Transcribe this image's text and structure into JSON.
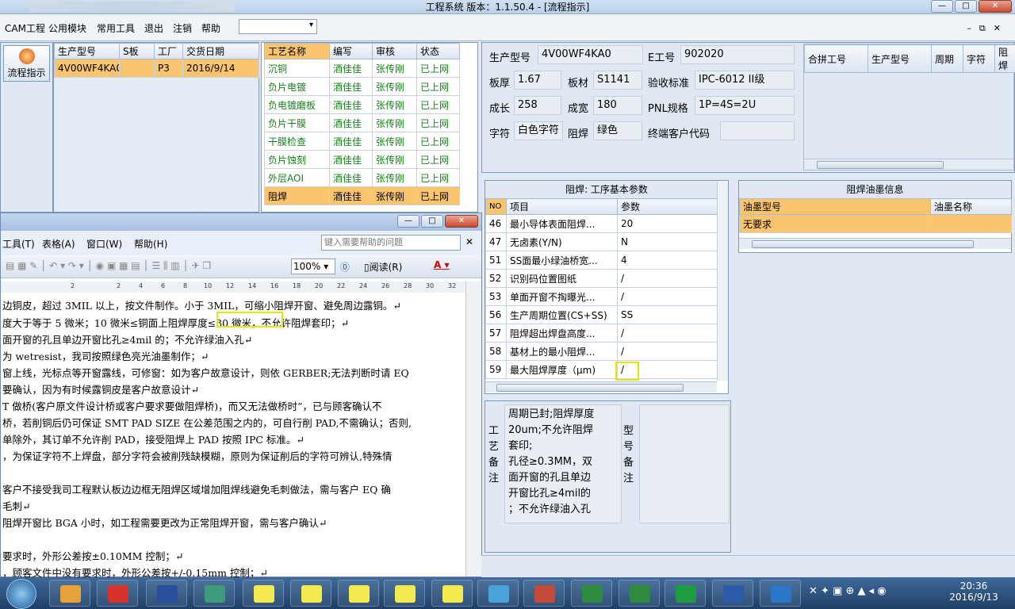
{
  "window": {
    "title": "工程系统    版本：1.1.50.4 - [流程指示]"
  },
  "menu": {
    "items": [
      "CAM工程",
      "公用模块",
      "常用工具",
      "退出",
      "注销",
      "帮助"
    ]
  },
  "leftbar": {
    "button_label": "流程指示"
  },
  "orders": {
    "headers": [
      "生产型号",
      "S板",
      "工厂",
      "交货日期"
    ],
    "rows": [
      [
        "4V00WF4KA0",
        "",
        "P3",
        "2016/9/14"
      ]
    ]
  },
  "process": {
    "headers": [
      "工艺名称",
      "编写",
      "审核",
      "状态"
    ],
    "rows": [
      [
        "沉铜",
        "酒佳佳",
        "张传刚",
        "已上网"
      ],
      [
        "负片电镀",
        "酒佳佳",
        "张传刚",
        "已上网"
      ],
      [
        "负电镀磨板",
        "酒佳佳",
        "张传刚",
        "已上网"
      ],
      [
        "负片干膜",
        "酒佳佳",
        "张传刚",
        "已上网"
      ],
      [
        "干膜检查",
        "酒佳佳",
        "张传刚",
        "已上网"
      ],
      [
        "负片蚀刻",
        "酒佳佳",
        "张传刚",
        "已上网"
      ],
      [
        "外层AOI",
        "酒佳佳",
        "张传刚",
        "已上网"
      ],
      [
        "阻焊",
        "酒佳佳",
        "张传刚",
        "已上网"
      ]
    ],
    "selected_index": 7
  },
  "info": {
    "labels": {
      "model": "生产型号",
      "eno": "E工号",
      "thick": "板厚",
      "mat": "板材",
      "std": "验收标准",
      "len": "成长",
      "wid": "成宽",
      "pnl": "PNL规格",
      "char": "字符",
      "mask": "阻焊",
      "cust": "终端客户代码"
    },
    "values": {
      "model": "4V00WF4KA0",
      "eno": "902020",
      "thick": "1.67",
      "mat": "S1141",
      "std": "IPC-6012 II级",
      "len": "258",
      "wid": "180",
      "pnl": "1P=4S=2U",
      "char": "白色字符",
      "mask": "绿色",
      "cust": ""
    }
  },
  "merge": {
    "headers": [
      "合拼工号",
      "生产型号",
      "周期",
      "字符",
      "阻焊"
    ]
  },
  "params": {
    "title": "阻焊: 工序基本参数",
    "headers": [
      "NO",
      "项目",
      "参数"
    ],
    "rows": [
      [
        "46",
        "最小导体表面阻焊...",
        "20"
      ],
      [
        "47",
        "无卤素(Y/N)",
        "N"
      ],
      [
        "51",
        "SS面最小绿油桥宽...",
        "4"
      ],
      [
        "52",
        "识别码位置图纸",
        "/"
      ],
      [
        "53",
        "单面开窗不掏曝光...",
        "/"
      ],
      [
        "56",
        "生产周期位置(CS+SS)",
        "SS"
      ],
      [
        "57",
        "阻焊超出焊盘高度...",
        "/"
      ],
      [
        "58",
        "基材上的最小阻焊...",
        "/"
      ],
      [
        "59",
        "最大阻焊厚度（μm)",
        "/"
      ]
    ]
  },
  "ink": {
    "title": "阻焊油墨信息",
    "headers": [
      "油墨型号",
      "油墨名称"
    ],
    "rows": [
      [
        "无要求",
        ""
      ]
    ]
  },
  "notes": {
    "craft_label": "工艺备注",
    "model_label": "型号备注",
    "craft_lines": [
      "周期已封;阻焊厚度",
      "20um;不允许阻焊",
      "套印;",
      "孔径≥0.3MM，双",
      "面开窗的孔且单边",
      "开窗比孔≥4mil的",
      "；不允许绿油入孔"
    ]
  },
  "word": {
    "menu": [
      "工具(T)",
      "表格(A)",
      "窗口(W)",
      "帮助(H)"
    ],
    "help_placeholder": "键入需要帮助的问题",
    "zoom": "100%",
    "read_label": "阅读(R)",
    "ruler": [
      "2",
      "2",
      "4",
      "6",
      "8",
      "10",
      "12",
      "14",
      "16",
      "18",
      "20",
      "22",
      "24",
      "26",
      "28",
      "30",
      "32"
    ],
    "lines": [
      "边铜皮，超过 3MIL 以上，按文件制作。小于 3MIL，可缩小阻焊开窗、避免周边露铜。↵",
      "度大于等于 5 微米；10 微米≤铜面上阻焊厚度≤30 微米，不允许阻焊套印；↵",
      "面开窗的孔且单边开窗比孔≥4mil 的；不允许绿油入孔↵",
      "为 wetresist，我司按照绿色亮光油墨制作；↵",
      "窗上线，光标点等开窗露线，可修窗：如为客户故意设计，则依 GERBER;无法判断时请 EQ",
      "要确认，因为有时候露铜皮是客户故意设计↵",
      "T 做桥(客户原文件设计桥或客户要求要做阻焊桥)，而又无法做桥时”，已与顾客确认不",
      "桥，若削铜后仍可保证 SMT PAD SIZE 在公差范围之内的，可自行削 PAD,不需确认；否则,",
      "单除外，其订单不允许削 PAD，接受阻焊上 PAD 按照 IPC 标准。↵",
      "，为保证字符不上焊盘，部分字符会被削残缺模糊，原则为保证削后的字符可辨认,特殊情",
      "",
      "客户不接受我司工程默认板边边框无阻焊区域增加阻焊线避免毛刺做法，需与客户 EQ 确",
      "毛刺↵",
      "阻焊开窗比 BGA 小时，如工程需要更改为正常阻焊开窗，需与客户确认↵",
      "",
      "要求时，外形公差按±0.10MM 控制；↵",
      "，顾客文件中没有要求时，外形公差按+/-0.15mm 控制；↵"
    ]
  },
  "taskbar": {
    "time": "20:36",
    "date": "2016/9/13"
  }
}
